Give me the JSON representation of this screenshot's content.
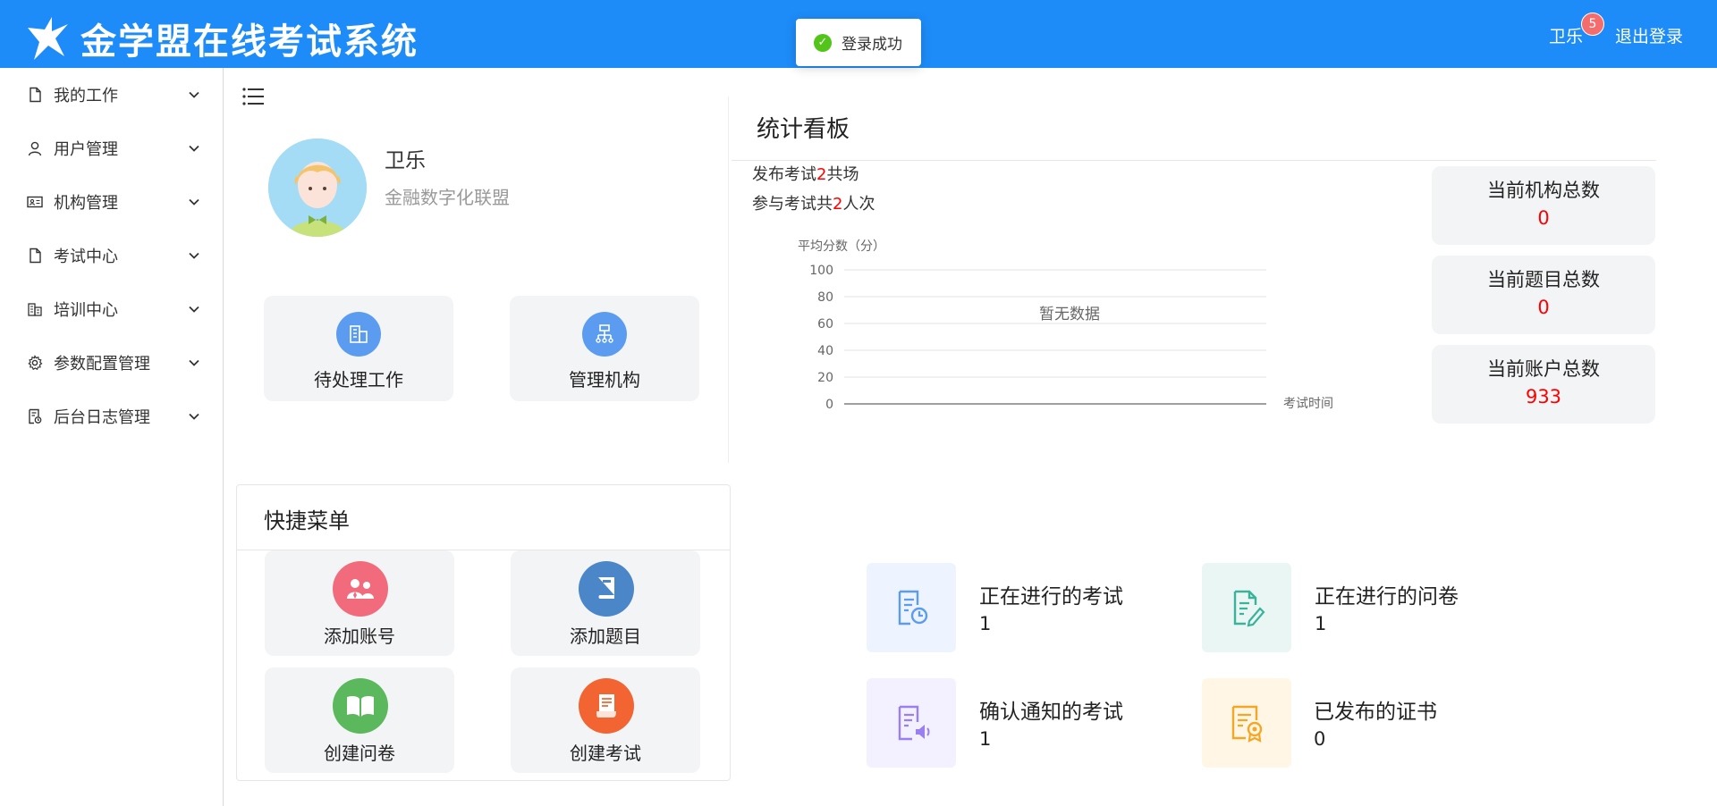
{
  "header": {
    "app_title": "金学盟在线考试系统",
    "user_name": "卫乐",
    "notification_count": "5",
    "logout_label": "退出登录",
    "brand_color": "#1d8cf8"
  },
  "toast": {
    "message": "登录成功",
    "icon": "check-circle-icon"
  },
  "sidebar": {
    "items": [
      {
        "label": "我的工作",
        "icon": "file-icon"
      },
      {
        "label": "用户管理",
        "icon": "user-icon"
      },
      {
        "label": "机构管理",
        "icon": "id-card-icon"
      },
      {
        "label": "考试中心",
        "icon": "file-icon"
      },
      {
        "label": "培训中心",
        "icon": "building-icon"
      },
      {
        "label": "参数配置管理",
        "icon": "gear-icon"
      },
      {
        "label": "后台日志管理",
        "icon": "log-file-icon"
      }
    ]
  },
  "profile": {
    "name": "卫乐",
    "org": "金融数字化联盟"
  },
  "quick_tiles": [
    {
      "label": "待处理工作",
      "icon": "building-icon"
    },
    {
      "label": "管理机构",
      "icon": "org-tree-icon"
    }
  ],
  "quick_menu": {
    "title": "快捷菜单",
    "items": [
      {
        "label": "添加账号",
        "icon": "users-icon",
        "color": "#f26b7d"
      },
      {
        "label": "添加题目",
        "icon": "book-icon",
        "color": "#4a86c8"
      },
      {
        "label": "创建问卷",
        "icon": "open-book-icon",
        "color": "#5cb85c"
      },
      {
        "label": "创建考试",
        "icon": "scroll-icon",
        "color": "#f26533"
      }
    ]
  },
  "stats": {
    "title": "统计看板",
    "exam_prefix": "发布考试",
    "exam_count": "2",
    "exam_suffix": "共场",
    "participate_prefix": "参与考试共",
    "participate_count": "2",
    "participate_suffix": "人次",
    "counts": [
      {
        "label": "当前机构总数",
        "value": "0"
      },
      {
        "label": "当前题目总数",
        "value": "0"
      },
      {
        "label": "当前账户总数",
        "value": "933"
      }
    ]
  },
  "chart_data": {
    "type": "line",
    "ylabel": "平均分数（分）",
    "xlabel": "考试时间",
    "ylim": [
      0,
      100
    ],
    "yticks": [
      "100",
      "80",
      "60",
      "40",
      "20",
      "0"
    ],
    "series": [],
    "empty_text": "暂无数据",
    "grid": true
  },
  "status_items": [
    {
      "label": "正在进行的考试",
      "value": "1",
      "icon": "exam-clock-icon",
      "color": "#5b9cf0",
      "bg": "#eef4ff"
    },
    {
      "label": "正在进行的问卷",
      "value": "1",
      "icon": "doc-edit-icon",
      "color": "#3bb39a",
      "bg": "#eaf6f3"
    },
    {
      "label": "确认通知的考试",
      "value": "1",
      "icon": "doc-announce-icon",
      "color": "#9a7ff0",
      "bg": "#f3f0ff"
    },
    {
      "label": "已发布的证书",
      "value": "0",
      "icon": "certificate-icon",
      "color": "#f5a623",
      "bg": "#fff6e6"
    }
  ]
}
